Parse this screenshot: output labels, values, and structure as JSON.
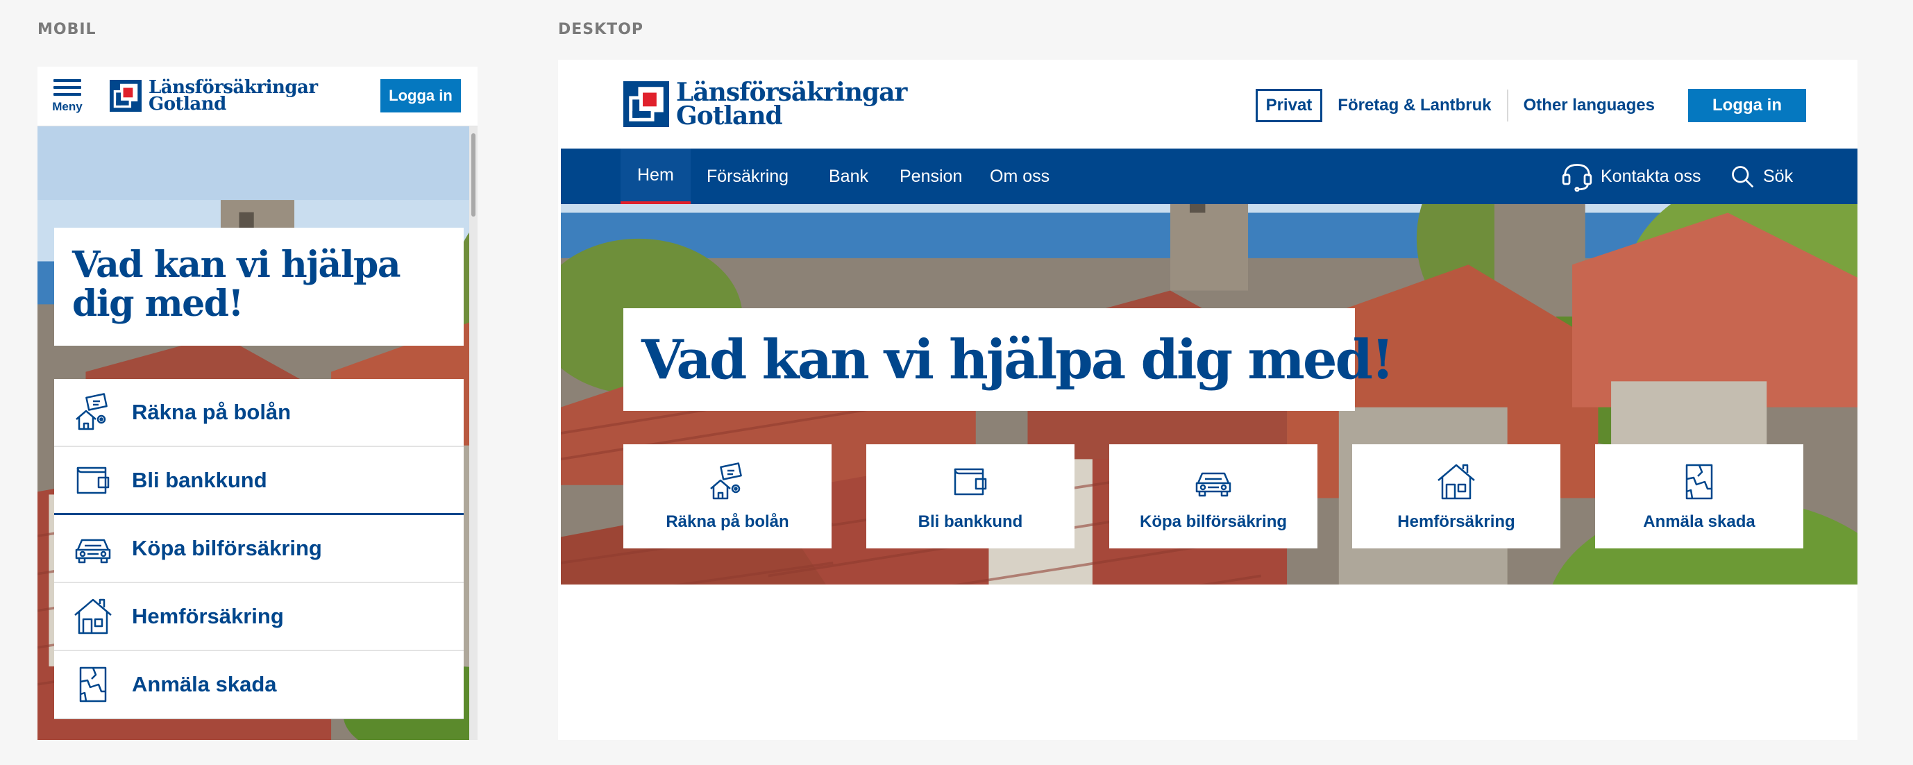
{
  "labels": {
    "mobile": "MOBIL",
    "desktop": "DESKTOP"
  },
  "brand": {
    "line1": "Länsförsäkringar",
    "line2": "Gotland"
  },
  "colors": {
    "brand_blue": "#00468c",
    "button_blue": "#0578c0",
    "nav_active_underline": "#e0212c"
  },
  "mobile": {
    "menu_label": "Meny",
    "login_label": "Logga in",
    "heading": "Vad kan vi hjälpa dig med!",
    "items": [
      {
        "label": "Räkna på bolån",
        "icon": "house-calculator-icon"
      },
      {
        "label": "Bli bankkund",
        "icon": "wallet-icon"
      },
      {
        "label": "Köpa bilförsäkring",
        "icon": "car-icon"
      },
      {
        "label": "Hemförsäkring",
        "icon": "home-icon"
      },
      {
        "label": "Anmäla skada",
        "icon": "damage-report-icon"
      }
    ]
  },
  "desktop": {
    "top_nav": {
      "privat": "Privat",
      "foretag": "Företag & Lantbruk",
      "other_languages": "Other languages",
      "login_label": "Logga in"
    },
    "main_nav": {
      "items": [
        "Hem",
        "Försäkring",
        "Bank",
        "Pension",
        "Om oss"
      ],
      "active": "Hem",
      "contact": "Kontakta oss",
      "search": "Sök"
    },
    "heading": "Vad kan vi hjälpa dig med!",
    "cards": [
      {
        "label": "Räkna på bolån",
        "icon": "house-calculator-icon"
      },
      {
        "label": "Bli bankkund",
        "icon": "wallet-icon"
      },
      {
        "label": "Köpa bilförsäkring",
        "icon": "car-icon"
      },
      {
        "label": "Hemförsäkring",
        "icon": "home-icon"
      },
      {
        "label": "Anmäla skada",
        "icon": "damage-report-icon"
      }
    ]
  }
}
